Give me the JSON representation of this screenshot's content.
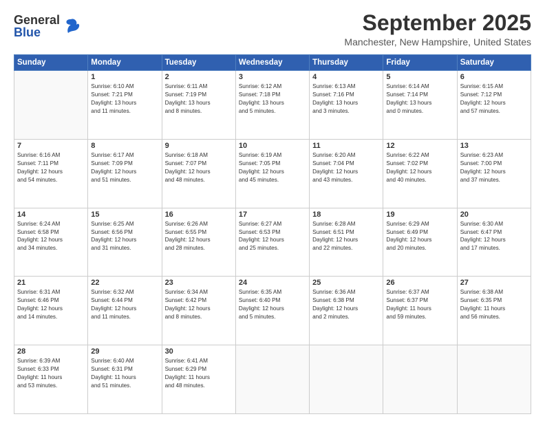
{
  "header": {
    "logo_general": "General",
    "logo_blue": "Blue",
    "month_year": "September 2025",
    "location": "Manchester, New Hampshire, United States"
  },
  "weekdays": [
    "Sunday",
    "Monday",
    "Tuesday",
    "Wednesday",
    "Thursday",
    "Friday",
    "Saturday"
  ],
  "weeks": [
    [
      {
        "day": "",
        "info": ""
      },
      {
        "day": "1",
        "info": "Sunrise: 6:10 AM\nSunset: 7:21 PM\nDaylight: 13 hours\nand 11 minutes."
      },
      {
        "day": "2",
        "info": "Sunrise: 6:11 AM\nSunset: 7:19 PM\nDaylight: 13 hours\nand 8 minutes."
      },
      {
        "day": "3",
        "info": "Sunrise: 6:12 AM\nSunset: 7:18 PM\nDaylight: 13 hours\nand 5 minutes."
      },
      {
        "day": "4",
        "info": "Sunrise: 6:13 AM\nSunset: 7:16 PM\nDaylight: 13 hours\nand 3 minutes."
      },
      {
        "day": "5",
        "info": "Sunrise: 6:14 AM\nSunset: 7:14 PM\nDaylight: 13 hours\nand 0 minutes."
      },
      {
        "day": "6",
        "info": "Sunrise: 6:15 AM\nSunset: 7:12 PM\nDaylight: 12 hours\nand 57 minutes."
      }
    ],
    [
      {
        "day": "7",
        "info": "Sunrise: 6:16 AM\nSunset: 7:11 PM\nDaylight: 12 hours\nand 54 minutes."
      },
      {
        "day": "8",
        "info": "Sunrise: 6:17 AM\nSunset: 7:09 PM\nDaylight: 12 hours\nand 51 minutes."
      },
      {
        "day": "9",
        "info": "Sunrise: 6:18 AM\nSunset: 7:07 PM\nDaylight: 12 hours\nand 48 minutes."
      },
      {
        "day": "10",
        "info": "Sunrise: 6:19 AM\nSunset: 7:05 PM\nDaylight: 12 hours\nand 45 minutes."
      },
      {
        "day": "11",
        "info": "Sunrise: 6:20 AM\nSunset: 7:04 PM\nDaylight: 12 hours\nand 43 minutes."
      },
      {
        "day": "12",
        "info": "Sunrise: 6:22 AM\nSunset: 7:02 PM\nDaylight: 12 hours\nand 40 minutes."
      },
      {
        "day": "13",
        "info": "Sunrise: 6:23 AM\nSunset: 7:00 PM\nDaylight: 12 hours\nand 37 minutes."
      }
    ],
    [
      {
        "day": "14",
        "info": "Sunrise: 6:24 AM\nSunset: 6:58 PM\nDaylight: 12 hours\nand 34 minutes."
      },
      {
        "day": "15",
        "info": "Sunrise: 6:25 AM\nSunset: 6:56 PM\nDaylight: 12 hours\nand 31 minutes."
      },
      {
        "day": "16",
        "info": "Sunrise: 6:26 AM\nSunset: 6:55 PM\nDaylight: 12 hours\nand 28 minutes."
      },
      {
        "day": "17",
        "info": "Sunrise: 6:27 AM\nSunset: 6:53 PM\nDaylight: 12 hours\nand 25 minutes."
      },
      {
        "day": "18",
        "info": "Sunrise: 6:28 AM\nSunset: 6:51 PM\nDaylight: 12 hours\nand 22 minutes."
      },
      {
        "day": "19",
        "info": "Sunrise: 6:29 AM\nSunset: 6:49 PM\nDaylight: 12 hours\nand 20 minutes."
      },
      {
        "day": "20",
        "info": "Sunrise: 6:30 AM\nSunset: 6:47 PM\nDaylight: 12 hours\nand 17 minutes."
      }
    ],
    [
      {
        "day": "21",
        "info": "Sunrise: 6:31 AM\nSunset: 6:46 PM\nDaylight: 12 hours\nand 14 minutes."
      },
      {
        "day": "22",
        "info": "Sunrise: 6:32 AM\nSunset: 6:44 PM\nDaylight: 12 hours\nand 11 minutes."
      },
      {
        "day": "23",
        "info": "Sunrise: 6:34 AM\nSunset: 6:42 PM\nDaylight: 12 hours\nand 8 minutes."
      },
      {
        "day": "24",
        "info": "Sunrise: 6:35 AM\nSunset: 6:40 PM\nDaylight: 12 hours\nand 5 minutes."
      },
      {
        "day": "25",
        "info": "Sunrise: 6:36 AM\nSunset: 6:38 PM\nDaylight: 12 hours\nand 2 minutes."
      },
      {
        "day": "26",
        "info": "Sunrise: 6:37 AM\nSunset: 6:37 PM\nDaylight: 11 hours\nand 59 minutes."
      },
      {
        "day": "27",
        "info": "Sunrise: 6:38 AM\nSunset: 6:35 PM\nDaylight: 11 hours\nand 56 minutes."
      }
    ],
    [
      {
        "day": "28",
        "info": "Sunrise: 6:39 AM\nSunset: 6:33 PM\nDaylight: 11 hours\nand 53 minutes."
      },
      {
        "day": "29",
        "info": "Sunrise: 6:40 AM\nSunset: 6:31 PM\nDaylight: 11 hours\nand 51 minutes."
      },
      {
        "day": "30",
        "info": "Sunrise: 6:41 AM\nSunset: 6:29 PM\nDaylight: 11 hours\nand 48 minutes."
      },
      {
        "day": "",
        "info": ""
      },
      {
        "day": "",
        "info": ""
      },
      {
        "day": "",
        "info": ""
      },
      {
        "day": "",
        "info": ""
      }
    ]
  ]
}
